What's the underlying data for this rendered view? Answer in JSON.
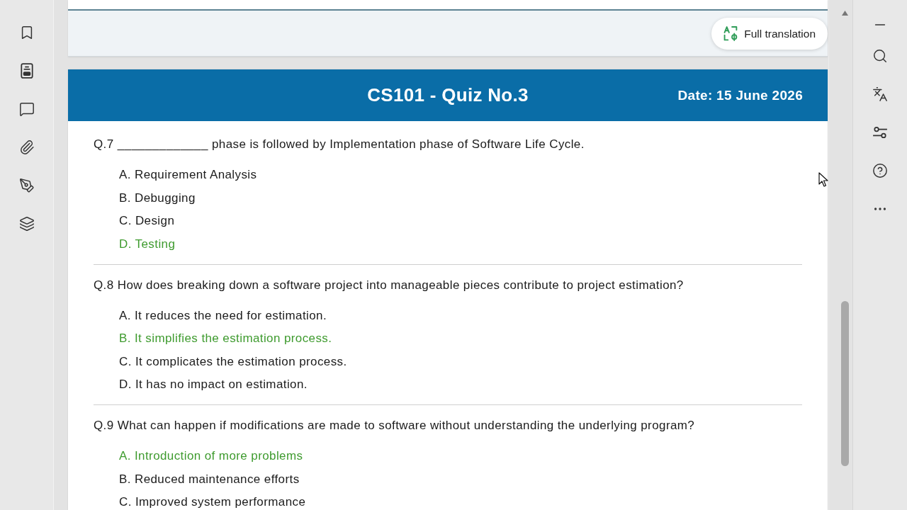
{
  "top_page": {
    "translate_button": {
      "label": "Full translation"
    }
  },
  "quiz": {
    "title": "CS101 - Quiz No.3",
    "date": "Date: 15 June 2026",
    "questions": [
      {
        "text": "Q.7 _____________ phase is followed by Implementation phase of Software Life Cycle.",
        "options": [
          {
            "label": "A. Requirement Analysis",
            "correct": false
          },
          {
            "label": "B. Debugging",
            "correct": false
          },
          {
            "label": "C. Design",
            "correct": false
          },
          {
            "label": "D. Testing",
            "correct": true
          }
        ]
      },
      {
        "text": "Q.8 How does breaking down a software project into manageable pieces contribute to project estimation?",
        "options": [
          {
            "label": "A. It reduces the need for estimation.",
            "correct": false
          },
          {
            "label": "B. It simplifies the estimation process.",
            "correct": true
          },
          {
            "label": "C. It complicates the estimation process.",
            "correct": false
          },
          {
            "label": "D. It has no impact on estimation.",
            "correct": false
          }
        ]
      },
      {
        "text": "Q.9 What can happen if modifications are made to software without understanding the underlying program?",
        "options": [
          {
            "label": "A. Introduction of more problems",
            "correct": true
          },
          {
            "label": "B. Reduced maintenance efforts",
            "correct": false
          },
          {
            "label": "C. Improved system performance",
            "correct": false
          }
        ]
      }
    ]
  }
}
